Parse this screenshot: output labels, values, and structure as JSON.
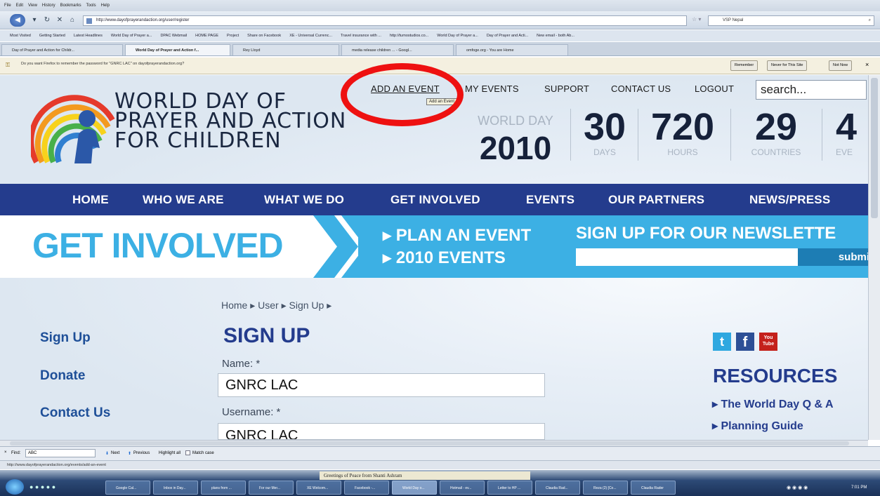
{
  "browser": {
    "menu": [
      "File",
      "Edit",
      "View",
      "History",
      "Bookmarks",
      "Tools",
      "Help"
    ],
    "url": "http://www.dayofprayerandaction.org/user/register",
    "search_engine_label": "VSP Nepal",
    "bookmarks": [
      "Most Visited",
      "Getting Started",
      "Latest Headlines",
      "World Day of Prayer a...",
      "DPAC Webmail",
      "HOME PAGE",
      "Project",
      "Share on Facebook",
      "XE - Universal Currenc...",
      "Travel insurance with ...",
      "http://tumostudios.co...",
      "World Day of Prayer a...",
      "Day of Prayer and Acti...",
      "New email - both Ab..."
    ],
    "tabs": [
      "Day of Prayer and Action for Childr...",
      "World Day of Prayer and Action f...",
      "Rey Lloyd",
      "media release children ... - Googl...",
      "omfoge.org - You are Home"
    ],
    "password_prompt": "Do you want Firefox to remember the password for \"GNRC LAC\" on dayofprayerandaction.org?",
    "password_buttons": [
      "Remember",
      "Never for This Site",
      "Not Now"
    ],
    "find": {
      "close": "×",
      "label": "Find:",
      "value": "ABC",
      "next": "Next",
      "previous": "Previous",
      "highlight": "Highlight all",
      "match_case": "Match case"
    },
    "status_url": "http://www.dayofprayerandaction.org/events/add-an-event",
    "notification": "Greetings of Peace from Shanti Ashram",
    "taskbar_items": [
      "Google Cal...",
      "Inbox in Day...",
      "plans from ...",
      "For our Mer...",
      "XE Welcom...",
      "Facebook -...",
      "World Day o...",
      "Hotmail - ev...",
      "Letter to HP ...",
      "Claudia Rad...",
      "Reza (2) [Co...",
      "Claudia Rader"
    ],
    "clock": "7:01 PM"
  },
  "site": {
    "top_nav": [
      "ADD AN EVENT",
      "MY EVENTS",
      "SUPPORT",
      "CONTACT US",
      "LOGOUT"
    ],
    "tooltip": "Add an Event",
    "search_placeholder": "search...",
    "logo_lines": [
      "WORLD DAY OF",
      "PRAYER AND ACTION",
      "FOR CHILDREN"
    ],
    "world_day_label": "WORLD DAY",
    "world_day_year": "2010",
    "stats": [
      {
        "value": "30",
        "label": "DAYS"
      },
      {
        "value": "720",
        "label": "HOURS"
      },
      {
        "value": "29",
        "label": "COUNTRIES"
      },
      {
        "value": "4",
        "label": "EVE"
      }
    ],
    "main_nav": [
      "HOME",
      "WHO WE ARE",
      "WHAT WE DO",
      "GET INVOLVED",
      "EVENTS",
      "OUR PARTNERS",
      "NEWS/PRESS"
    ],
    "banner": {
      "title": "GET INVOLVED",
      "links": [
        "PLAN AN EVENT",
        "2010 EVENTS"
      ],
      "newsletter": "SIGN UP FOR OUR NEWSLETTE",
      "submit": "submit"
    },
    "breadcrumb": "Home ▸ User ▸ Sign Up ▸",
    "sidebar": [
      "Sign Up",
      "Donate",
      "Contact Us"
    ],
    "heading": "SIGN UP",
    "fields": [
      {
        "label": "Name: *",
        "value": "GNRC LAC"
      },
      {
        "label": "Username: *",
        "value": "GNRC LAC"
      }
    ],
    "social": [
      "t",
      "f",
      "You Tube"
    ],
    "resources_heading": "RESOURCES",
    "resources": [
      "The World Day Q & A",
      "Planning Guide"
    ]
  },
  "colors": {
    "annotation": "#ee1111",
    "nav_blue": "#243c8d",
    "banner_blue": "#3cb0e4"
  }
}
